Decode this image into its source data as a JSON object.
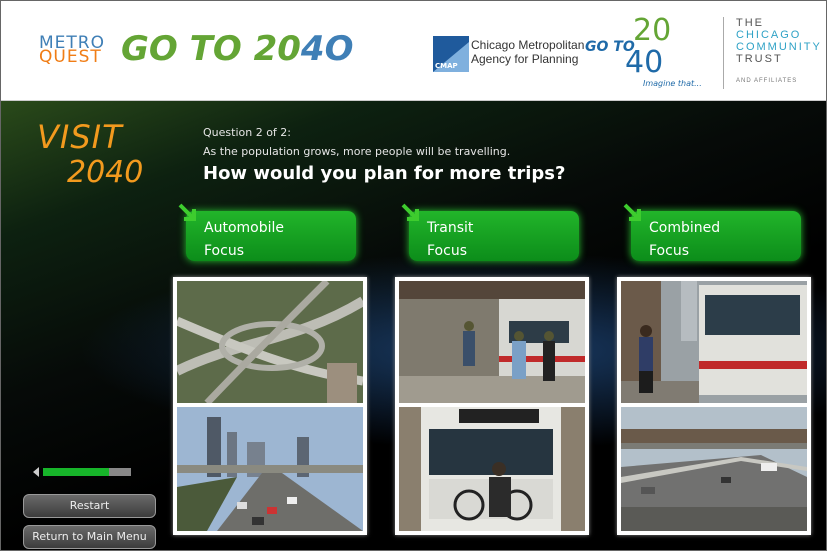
{
  "header": {
    "metroquest_top": "METRO",
    "metroquest_bottom": "QUEST",
    "title_prefix": "GO TO 20",
    "title_suffix": "4O",
    "cmap_abbr": "CMAP",
    "cmap_line1": "Chicago Metropolitan",
    "cmap_line2": "Agency for Planning",
    "goto_text": "GO TO",
    "goto_20": "20",
    "goto_40": "40",
    "goto_tagline": "Imagine that...",
    "trust_line1": "THE",
    "trust_line2": "CHICAGO",
    "trust_line3": "COMMUNITY",
    "trust_line4": "TRUST",
    "trust_line5": "AND AFFILIATES"
  },
  "section": {
    "visit_word": "VISIT",
    "visit_year": "2040"
  },
  "question": {
    "number": "Question 2 of 2:",
    "description": "As the population grows, more people will be travelling.",
    "title": "How would you plan for more trips?"
  },
  "options": [
    {
      "label": "Automobile\nFocus"
    },
    {
      "label": "Transit\nFocus"
    },
    {
      "label": "Combined\nFocus"
    }
  ],
  "progress": {
    "fraction": 0.75
  },
  "buttons": {
    "restart": "Restart",
    "main_menu": "Return to Main Menu"
  },
  "colors": {
    "accent_green": "#1aa526",
    "visit_orange": "#f29a1e",
    "brand_blue": "#3f7fb6"
  }
}
